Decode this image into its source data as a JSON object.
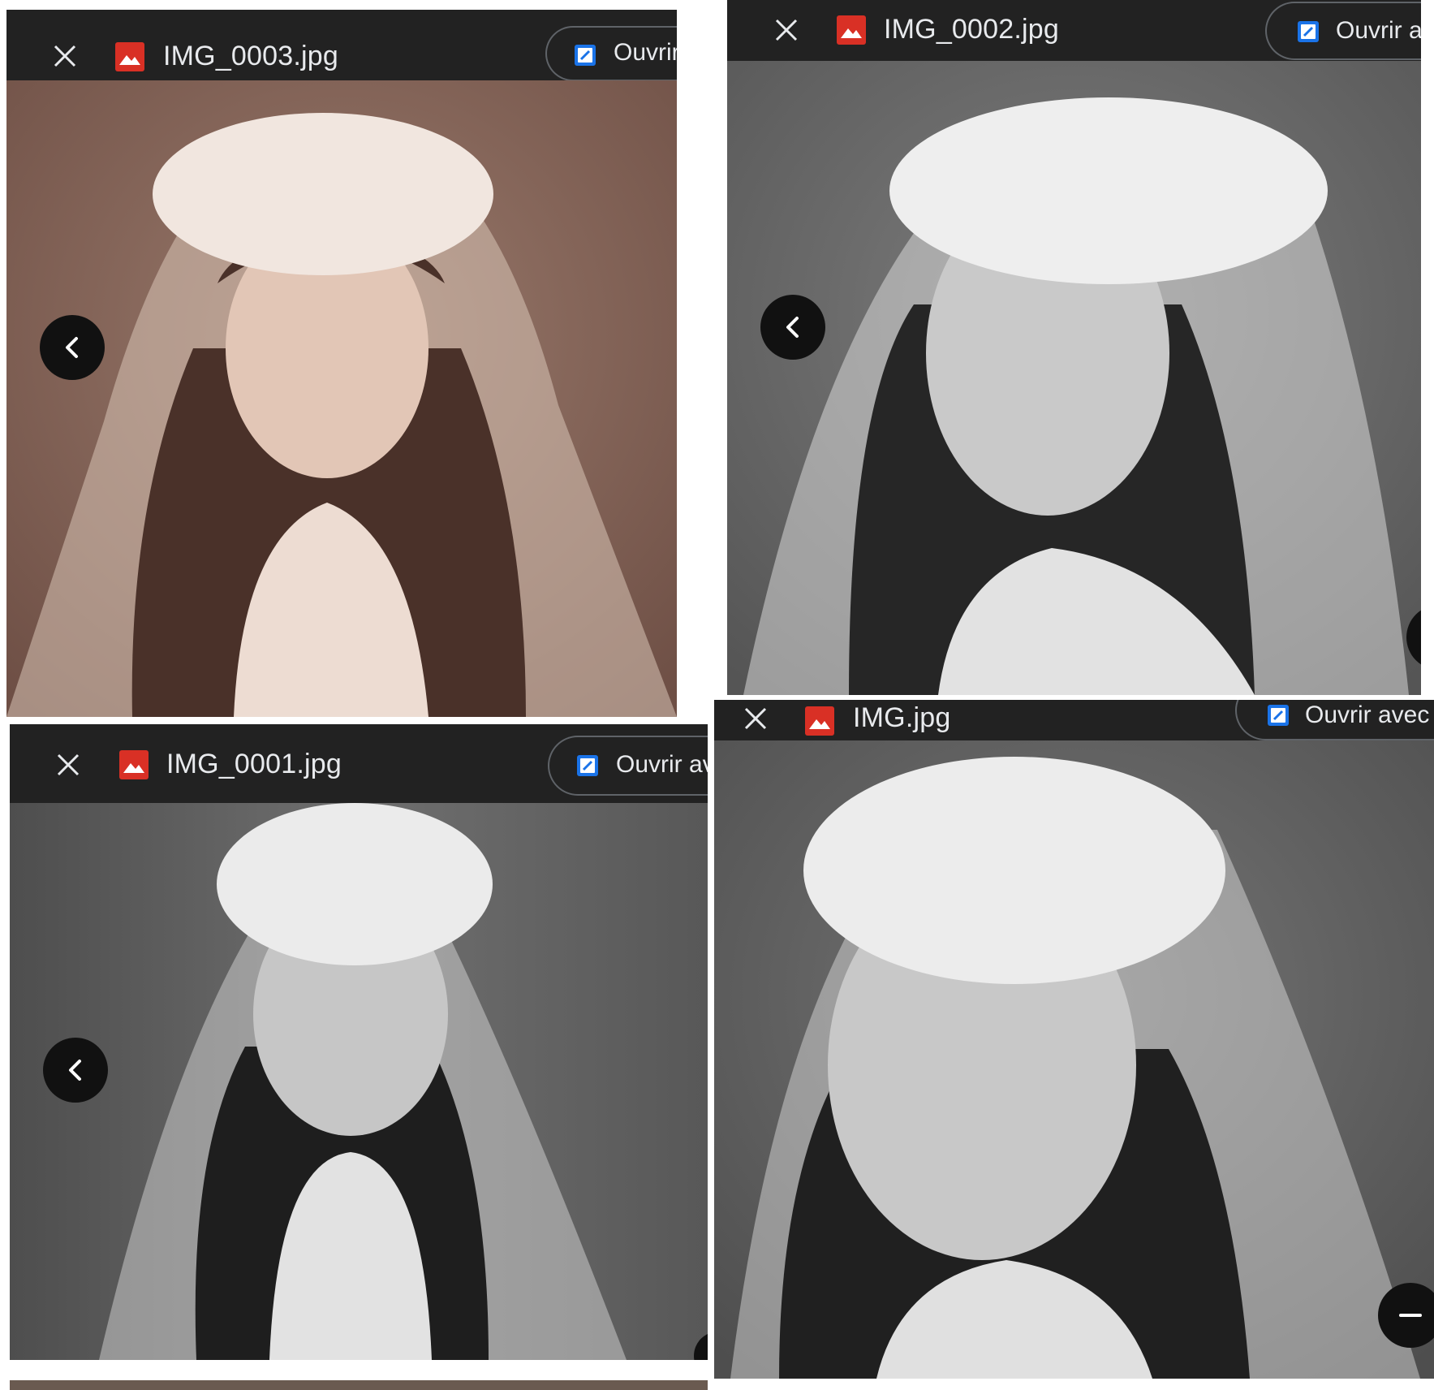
{
  "panels": [
    {
      "file_name": "IMG_0003.jpg",
      "open_with_label": "Ouvrir avec",
      "photo_tone": "#8a6a5e",
      "photo_light": "#d9c4b6",
      "photo_dark": "#4a3129"
    },
    {
      "file_name": "IMG_0002.jpg",
      "open_with_label": "Ouvrir avec",
      "photo_tone": "#6e6e6e",
      "photo_light": "#e6e6e6",
      "photo_dark": "#262626"
    },
    {
      "file_name": "IMG_0001.jpg",
      "open_with_label": "Ouvrir avec",
      "photo_tone": "#707070",
      "photo_light": "#e2e2e2",
      "photo_dark": "#1e1e1e"
    },
    {
      "file_name": "IMG.jpg",
      "open_with_label": "Ouvrir avec",
      "photo_tone": "#6a6a6a",
      "photo_light": "#e4e4e4",
      "photo_dark": "#202020"
    }
  ],
  "icons": {
    "close": "close-icon",
    "file": "image-file-icon",
    "open_with_app": "photo-editor-app-icon",
    "previous": "chevron-left-icon",
    "zoom_out": "minus-icon"
  },
  "colors": {
    "toolbar_bg": "#222222",
    "toolbar_text": "#e8eaed",
    "file_icon_red": "#d93025",
    "app_icon_blue": "#1a73e8",
    "nav_button_bg": "#111111"
  }
}
